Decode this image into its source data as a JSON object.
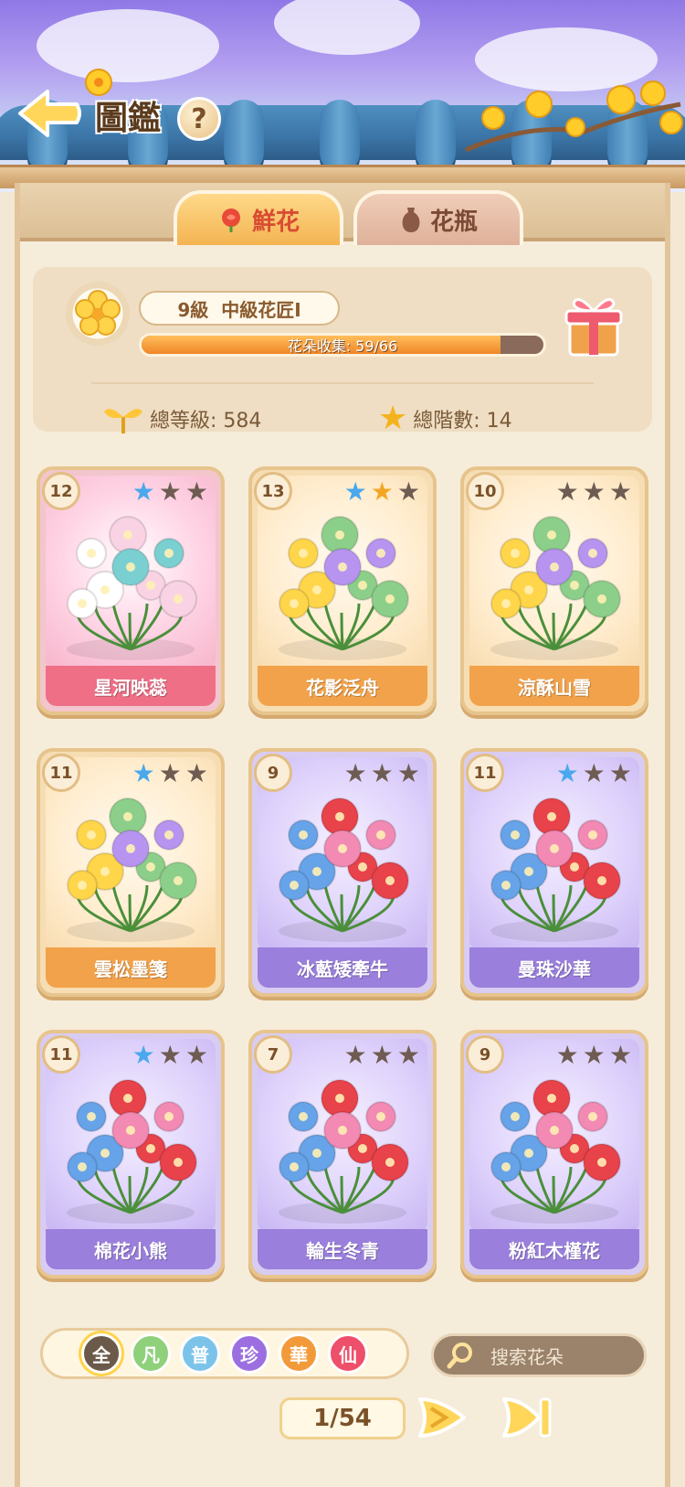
{
  "header": {
    "title": "圖鑑",
    "help_label": "?"
  },
  "tabs": [
    {
      "label": "鮮花",
      "active": true
    },
    {
      "label": "花瓶",
      "active": false
    }
  ],
  "stats": {
    "level_number": "9級",
    "level_title": "中級花匠Ⅰ",
    "progress_text": "花朵收集: 59/66",
    "progress_fraction": 0.894,
    "total_level": "總等級: 584",
    "total_tiers": "總階數: 14"
  },
  "cards": [
    {
      "name": "星河映蕊",
      "level": "12",
      "stars": [
        "blue",
        "gray",
        "gray"
      ],
      "theme": "pink"
    },
    {
      "name": "花影泛舟",
      "level": "13",
      "stars": [
        "blue",
        "gold",
        "gray"
      ],
      "theme": "orange"
    },
    {
      "name": "涼酥山雪",
      "level": "10",
      "stars": [
        "gray",
        "gray",
        "gray"
      ],
      "theme": "orange"
    },
    {
      "name": "雲松墨箋",
      "level": "11",
      "stars": [
        "blue",
        "gray",
        "gray"
      ],
      "theme": "orange"
    },
    {
      "name": "冰藍矮牽牛",
      "level": "9",
      "stars": [
        "gray",
        "gray",
        "gray"
      ],
      "theme": "purple"
    },
    {
      "name": "曼珠沙華",
      "level": "11",
      "stars": [
        "blue",
        "gray",
        "gray"
      ],
      "theme": "purple"
    },
    {
      "name": "棉花小熊",
      "level": "11",
      "stars": [
        "blue",
        "gray",
        "gray"
      ],
      "theme": "purple"
    },
    {
      "name": "輪生冬青",
      "level": "7",
      "stars": [
        "gray",
        "gray",
        "gray"
      ],
      "theme": "purple"
    },
    {
      "name": "粉紅木槿花",
      "level": "9",
      "stars": [
        "gray",
        "gray",
        "gray"
      ],
      "theme": "purple"
    }
  ],
  "filters": [
    {
      "label": "全",
      "color": "#6b5a4a",
      "selected": true
    },
    {
      "label": "凡",
      "color": "#8fd07a",
      "selected": false
    },
    {
      "label": "普",
      "color": "#7cc3ea",
      "selected": false
    },
    {
      "label": "珍",
      "color": "#9c6fe0",
      "selected": false
    },
    {
      "label": "華",
      "color": "#f29a3a",
      "selected": false
    },
    {
      "label": "仙",
      "color": "#ee4f6a",
      "selected": false
    }
  ],
  "search": {
    "placeholder": "搜索花朵"
  },
  "pagination": {
    "page": "1/54"
  },
  "colors": {
    "star_blue": "#4aa8ec",
    "star_gold": "#f4a623",
    "star_gray": "#6e5c52"
  }
}
